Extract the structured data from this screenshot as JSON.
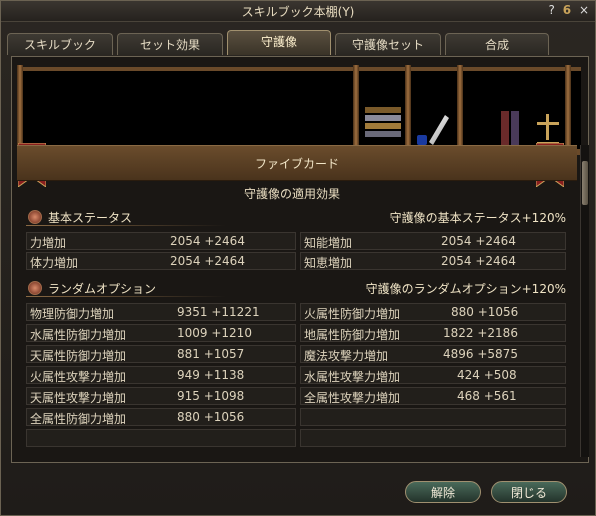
{
  "window": {
    "title": "スキルブック本棚(Y)",
    "help_icon": "?",
    "setting_icon": "6",
    "close_icon": "×"
  },
  "tabs": [
    {
      "label": "スキルブック"
    },
    {
      "label": "セット効果"
    },
    {
      "label": "守護像"
    },
    {
      "label": "守護像セット"
    },
    {
      "label": "合成"
    }
  ],
  "active_tab": 2,
  "card": {
    "name": "ファイブカード",
    "subtitle": "守護像の適用効果"
  },
  "basic": {
    "label": "基本ステータス",
    "right_label": "守護像の基本ステータス+120%",
    "stats": [
      {
        "name": "力増加",
        "value": "2054 +2464"
      },
      {
        "name": "知能増加",
        "value": "2054 +2464"
      },
      {
        "name": "体力増加",
        "value": "2054 +2464"
      },
      {
        "name": "知恵増加",
        "value": "2054 +2464"
      }
    ]
  },
  "random": {
    "label": "ランダムオプション",
    "right_label": "守護像のランダムオプション+120%",
    "left": [
      {
        "name": "物理防御力増加",
        "value": "9351 +11221"
      },
      {
        "name": "水属性防御力増加",
        "value": "1009 +1210"
      },
      {
        "name": "天属性防御力増加",
        "value": "881 +1057"
      },
      {
        "name": "火属性攻撃力増加",
        "value": "949 +1138"
      },
      {
        "name": "天属性攻撃力増加",
        "value": "915 +1098"
      },
      {
        "name": "全属性防御力増加",
        "value": "880 +1056"
      },
      {
        "name": "",
        "value": ""
      }
    ],
    "right": [
      {
        "name": "火属性防御力増加",
        "value": "880 +1056"
      },
      {
        "name": "地属性防御力増加",
        "value": "1822 +2186"
      },
      {
        "name": "魔法攻撃力増加",
        "value": "4896 +5875"
      },
      {
        "name": "水属性攻撃力増加",
        "value": "424 +508"
      },
      {
        "name": "全属性攻撃力増加",
        "value": "468 +561"
      },
      {
        "name": "",
        "value": ""
      },
      {
        "name": "",
        "value": ""
      }
    ]
  },
  "buttons": {
    "release": "解除",
    "close": "閉じる"
  }
}
